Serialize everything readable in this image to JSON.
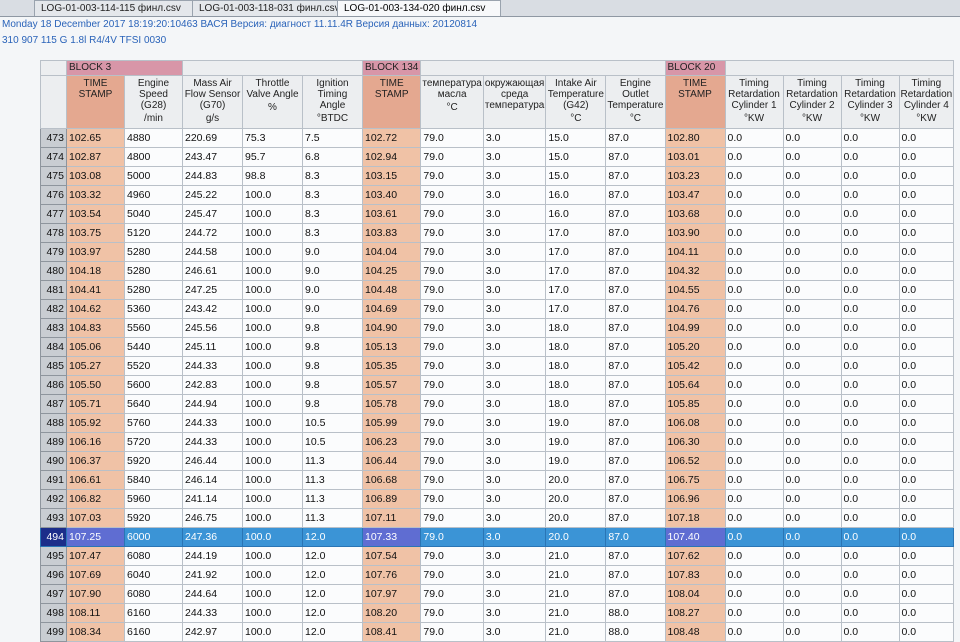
{
  "tabs": [
    {
      "label": "LOG-01-003-114-115 финл.csv"
    },
    {
      "label": "LOG-01-003-118-031 финл.csv"
    },
    {
      "label": "LOG-01-003-134-020 финл.csv"
    }
  ],
  "info": {
    "line1": "Monday 18 December 2017 18:19:20:10463 ВАСЯ Версия: диагност 11.11.4R Версия данных: 20120814",
    "line2": "310 907 115 G  1.8l R4/4V TFSI     0030"
  },
  "blocks": [
    {
      "label": "BLOCK 3"
    },
    {
      "label": ""
    },
    {
      "label": "BLOCK 134"
    },
    {
      "label": ""
    },
    {
      "label": "BLOCK 20"
    },
    {
      "label": ""
    }
  ],
  "columns": [
    {
      "name": "TIME STAMP",
      "unit": ""
    },
    {
      "name": "Engine Speed (G28)",
      "unit": "/min"
    },
    {
      "name": "Mass Air Flow Sensor (G70)",
      "unit": "g/s"
    },
    {
      "name": "Throttle Valve Angle",
      "unit": "%"
    },
    {
      "name": "Ignition Timing Angle",
      "unit": "°BTDC"
    },
    {
      "name": "TIME STAMP",
      "unit": ""
    },
    {
      "name": "температура масла",
      "unit": "°C"
    },
    {
      "name": "окружающая среда температура",
      "unit": ""
    },
    {
      "name": "Intake Air Temperature (G42)",
      "unit": "°C"
    },
    {
      "name": "Engine Outlet Temperature",
      "unit": "°C"
    },
    {
      "name": "TIME STAMP",
      "unit": ""
    },
    {
      "name": "Timing Retardation Cylinder 1",
      "unit": "°KW"
    },
    {
      "name": "Timing Retardation Cylinder 2",
      "unit": "°KW"
    },
    {
      "name": "Timing Retardation Cylinder 3",
      "unit": "°KW"
    },
    {
      "name": "Timing Retardation Cylinder 4",
      "unit": "°KW"
    }
  ],
  "selected_row": 494,
  "rows": [
    [
      "473",
      "102.65",
      "4880",
      "220.69",
      "75.3",
      "7.5",
      "102.72",
      "79.0",
      "3.0",
      "15.0",
      "87.0",
      "102.80",
      "0.0",
      "0.0",
      "0.0",
      "0.0"
    ],
    [
      "474",
      "102.87",
      "4800",
      "243.47",
      "95.7",
      "6.8",
      "102.94",
      "79.0",
      "3.0",
      "15.0",
      "87.0",
      "103.01",
      "0.0",
      "0.0",
      "0.0",
      "0.0"
    ],
    [
      "475",
      "103.08",
      "5000",
      "244.83",
      "98.8",
      "8.3",
      "103.15",
      "79.0",
      "3.0",
      "15.0",
      "87.0",
      "103.23",
      "0.0",
      "0.0",
      "0.0",
      "0.0"
    ],
    [
      "476",
      "103.32",
      "4960",
      "245.22",
      "100.0",
      "8.3",
      "103.40",
      "79.0",
      "3.0",
      "16.0",
      "87.0",
      "103.47",
      "0.0",
      "0.0",
      "0.0",
      "0.0"
    ],
    [
      "477",
      "103.54",
      "5040",
      "245.47",
      "100.0",
      "8.3",
      "103.61",
      "79.0",
      "3.0",
      "16.0",
      "87.0",
      "103.68",
      "0.0",
      "0.0",
      "0.0",
      "0.0"
    ],
    [
      "478",
      "103.75",
      "5120",
      "244.72",
      "100.0",
      "8.3",
      "103.83",
      "79.0",
      "3.0",
      "17.0",
      "87.0",
      "103.90",
      "0.0",
      "0.0",
      "0.0",
      "0.0"
    ],
    [
      "479",
      "103.97",
      "5280",
      "244.58",
      "100.0",
      "9.0",
      "104.04",
      "79.0",
      "3.0",
      "17.0",
      "87.0",
      "104.11",
      "0.0",
      "0.0",
      "0.0",
      "0.0"
    ],
    [
      "480",
      "104.18",
      "5280",
      "246.61",
      "100.0",
      "9.0",
      "104.25",
      "79.0",
      "3.0",
      "17.0",
      "87.0",
      "104.32",
      "0.0",
      "0.0",
      "0.0",
      "0.0"
    ],
    [
      "481",
      "104.41",
      "5280",
      "247.25",
      "100.0",
      "9.0",
      "104.48",
      "79.0",
      "3.0",
      "17.0",
      "87.0",
      "104.55",
      "0.0",
      "0.0",
      "0.0",
      "0.0"
    ],
    [
      "482",
      "104.62",
      "5360",
      "243.42",
      "100.0",
      "9.0",
      "104.69",
      "79.0",
      "3.0",
      "17.0",
      "87.0",
      "104.76",
      "0.0",
      "0.0",
      "0.0",
      "0.0"
    ],
    [
      "483",
      "104.83",
      "5560",
      "245.56",
      "100.0",
      "9.8",
      "104.90",
      "79.0",
      "3.0",
      "18.0",
      "87.0",
      "104.99",
      "0.0",
      "0.0",
      "0.0",
      "0.0"
    ],
    [
      "484",
      "105.06",
      "5440",
      "245.11",
      "100.0",
      "9.8",
      "105.13",
      "79.0",
      "3.0",
      "18.0",
      "87.0",
      "105.20",
      "0.0",
      "0.0",
      "0.0",
      "0.0"
    ],
    [
      "485",
      "105.27",
      "5520",
      "244.33",
      "100.0",
      "9.8",
      "105.35",
      "79.0",
      "3.0",
      "18.0",
      "87.0",
      "105.42",
      "0.0",
      "0.0",
      "0.0",
      "0.0"
    ],
    [
      "486",
      "105.50",
      "5600",
      "242.83",
      "100.0",
      "9.8",
      "105.57",
      "79.0",
      "3.0",
      "18.0",
      "87.0",
      "105.64",
      "0.0",
      "0.0",
      "0.0",
      "0.0"
    ],
    [
      "487",
      "105.71",
      "5640",
      "244.94",
      "100.0",
      "9.8",
      "105.78",
      "79.0",
      "3.0",
      "18.0",
      "87.0",
      "105.85",
      "0.0",
      "0.0",
      "0.0",
      "0.0"
    ],
    [
      "488",
      "105.92",
      "5760",
      "244.33",
      "100.0",
      "10.5",
      "105.99",
      "79.0",
      "3.0",
      "19.0",
      "87.0",
      "106.08",
      "0.0",
      "0.0",
      "0.0",
      "0.0"
    ],
    [
      "489",
      "106.16",
      "5720",
      "244.33",
      "100.0",
      "10.5",
      "106.23",
      "79.0",
      "3.0",
      "19.0",
      "87.0",
      "106.30",
      "0.0",
      "0.0",
      "0.0",
      "0.0"
    ],
    [
      "490",
      "106.37",
      "5920",
      "246.44",
      "100.0",
      "11.3",
      "106.44",
      "79.0",
      "3.0",
      "19.0",
      "87.0",
      "106.52",
      "0.0",
      "0.0",
      "0.0",
      "0.0"
    ],
    [
      "491",
      "106.61",
      "5840",
      "246.14",
      "100.0",
      "11.3",
      "106.68",
      "79.0",
      "3.0",
      "20.0",
      "87.0",
      "106.75",
      "0.0",
      "0.0",
      "0.0",
      "0.0"
    ],
    [
      "492",
      "106.82",
      "5960",
      "241.14",
      "100.0",
      "11.3",
      "106.89",
      "79.0",
      "3.0",
      "20.0",
      "87.0",
      "106.96",
      "0.0",
      "0.0",
      "0.0",
      "0.0"
    ],
    [
      "493",
      "107.03",
      "5920",
      "246.75",
      "100.0",
      "11.3",
      "107.11",
      "79.0",
      "3.0",
      "20.0",
      "87.0",
      "107.18",
      "0.0",
      "0.0",
      "0.0",
      "0.0"
    ],
    [
      "494",
      "107.25",
      "6000",
      "247.36",
      "100.0",
      "12.0",
      "107.33",
      "79.0",
      "3.0",
      "20.0",
      "87.0",
      "107.40",
      "0.0",
      "0.0",
      "0.0",
      "0.0"
    ],
    [
      "495",
      "107.47",
      "6080",
      "244.19",
      "100.0",
      "12.0",
      "107.54",
      "79.0",
      "3.0",
      "21.0",
      "87.0",
      "107.62",
      "0.0",
      "0.0",
      "0.0",
      "0.0"
    ],
    [
      "496",
      "107.69",
      "6040",
      "241.92",
      "100.0",
      "12.0",
      "107.76",
      "79.0",
      "3.0",
      "21.0",
      "87.0",
      "107.83",
      "0.0",
      "0.0",
      "0.0",
      "0.0"
    ],
    [
      "497",
      "107.90",
      "6080",
      "244.64",
      "100.0",
      "12.0",
      "107.97",
      "79.0",
      "3.0",
      "21.0",
      "87.0",
      "108.04",
      "0.0",
      "0.0",
      "0.0",
      "0.0"
    ],
    [
      "498",
      "108.11",
      "6160",
      "244.33",
      "100.0",
      "12.0",
      "108.20",
      "79.0",
      "3.0",
      "21.0",
      "88.0",
      "108.27",
      "0.0",
      "0.0",
      "0.0",
      "0.0"
    ],
    [
      "499",
      "108.34",
      "6160",
      "242.97",
      "100.0",
      "12.0",
      "108.41",
      "79.0",
      "3.0",
      "21.0",
      "88.0",
      "108.48",
      "0.0",
      "0.0",
      "0.0",
      "0.0"
    ]
  ]
}
